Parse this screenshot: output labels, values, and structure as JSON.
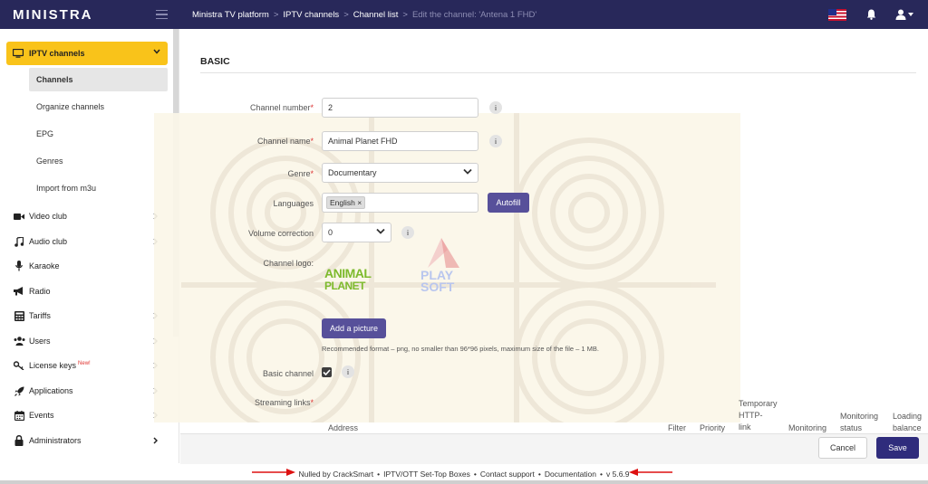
{
  "app": {
    "logo": "MINISTRA"
  },
  "breadcrumb": {
    "items": [
      "Ministra TV platform",
      "IPTV channels",
      "Channel list"
    ],
    "current": "Edit the channel: 'Antena 1 FHD'",
    "separator": ">"
  },
  "sidebar": {
    "main": {
      "label": "IPTV channels",
      "icon": "tv-icon"
    },
    "sub_items": [
      "Channels",
      "Organize channels",
      "EPG",
      "Genres",
      "Import from m3u"
    ],
    "items": [
      {
        "label": "Video club",
        "icon": "video-camera-icon"
      },
      {
        "label": "Audio club",
        "icon": "music-note-icon"
      },
      {
        "label": "Karaoke",
        "icon": "microphone-icon"
      },
      {
        "label": "Radio",
        "icon": "megaphone-icon"
      },
      {
        "label": "Tariffs",
        "icon": "calculator-icon"
      },
      {
        "label": "Users",
        "icon": "users-icon"
      },
      {
        "label": "License keys",
        "icon": "key-icon",
        "badge": "New!"
      },
      {
        "label": "Applications",
        "icon": "rocket-icon"
      },
      {
        "label": "Events",
        "icon": "calendar-icon"
      },
      {
        "label": "Administrators",
        "icon": "lock-icon"
      }
    ]
  },
  "form": {
    "section_title": "BASIC",
    "channel_number": {
      "label": "Channel number",
      "value": "2"
    },
    "channel_name": {
      "label": "Channel name",
      "value": "Animal Planet FHD"
    },
    "genre": {
      "label": "Genre",
      "value": "Documentary"
    },
    "languages": {
      "label": "Languages",
      "tag": "English",
      "autofill": "Autofill"
    },
    "volume_correction": {
      "label": "Volume correction",
      "value": "0"
    },
    "channel_logo": {
      "label": "Channel logo:",
      "logo_line1": "ANIMAL",
      "logo_line2": "PLANET",
      "add_picture": "Add a picture",
      "note": "Recommended format – png, no smaller than 96*96 pixels, maximum size of the file – 1 MB."
    },
    "basic_channel": {
      "label": "Basic channel",
      "checked": true
    },
    "streaming_links": {
      "label": "Streaming links"
    }
  },
  "table": {
    "headers": {
      "address": "Address",
      "filter": "Filter",
      "priority": "Priority",
      "temp_http": [
        "Temporary",
        "HTTP-",
        "link"
      ],
      "monitoring": "Monitoring",
      "monitoring_status": [
        "Monitoring",
        "status"
      ],
      "loading_balance": [
        "Loading",
        "balance"
      ]
    }
  },
  "watermark": {
    "text_line1": "PLAY",
    "text_line2": "SOFT"
  },
  "actions": {
    "cancel": "Cancel",
    "save": "Save"
  },
  "footer": {
    "nulled": "Nulled by CrackSmart",
    "boxes": "IPTV/OTT Set-Top Boxes",
    "support": "Contact support",
    "docs": "Documentation",
    "version": "v 5.6.9"
  },
  "colors": {
    "topbar": "#28285a",
    "accent": "#f9c31a",
    "primary": "#57509a",
    "save": "#2f2c7c"
  }
}
